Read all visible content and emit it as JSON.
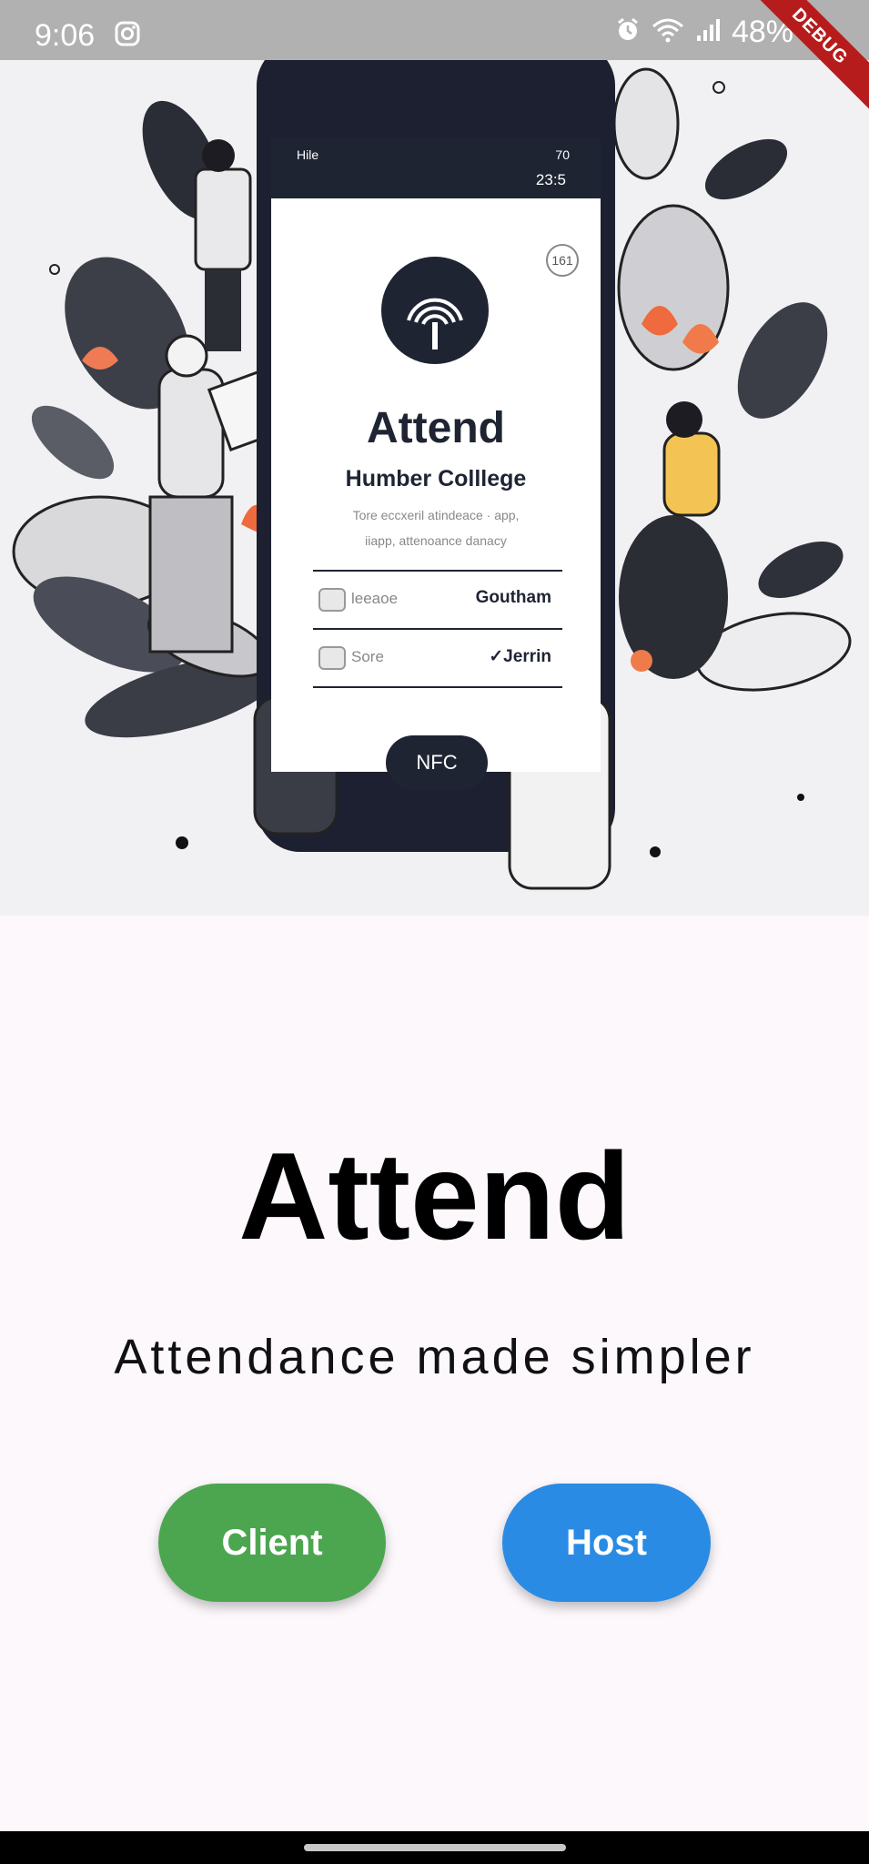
{
  "status_bar": {
    "time": "9:06",
    "battery": "48%",
    "debug_label": "DEBUG",
    "icons": [
      "instagram-icon",
      "alarm-icon",
      "wifi-icon",
      "signal-icon",
      "battery-icon"
    ]
  },
  "hero": {
    "phone": {
      "carrier": "Hile",
      "signal": "70",
      "clock": "23:5",
      "badge": "161",
      "app_title": "Attend",
      "college": "Humber Colllege",
      "tagline_1": "Tore eccxeril atindeace · app,",
      "tagline_2": "iiapp, attenoance danacy",
      "rows": [
        {
          "label": "leeaoe",
          "value": "Goutham"
        },
        {
          "label": "Sore",
          "value": "✓Jerrin"
        }
      ],
      "nfc_label": "NFC"
    }
  },
  "main": {
    "title": "Attend",
    "subtitle": "Attendance made simpler",
    "buttons": {
      "client": "Client",
      "host": "Host"
    }
  },
  "colors": {
    "client_button": "#4ca64f",
    "host_button": "#2a8be4",
    "background": "#fcf8fc",
    "status_bar": "#b1b1b1"
  }
}
